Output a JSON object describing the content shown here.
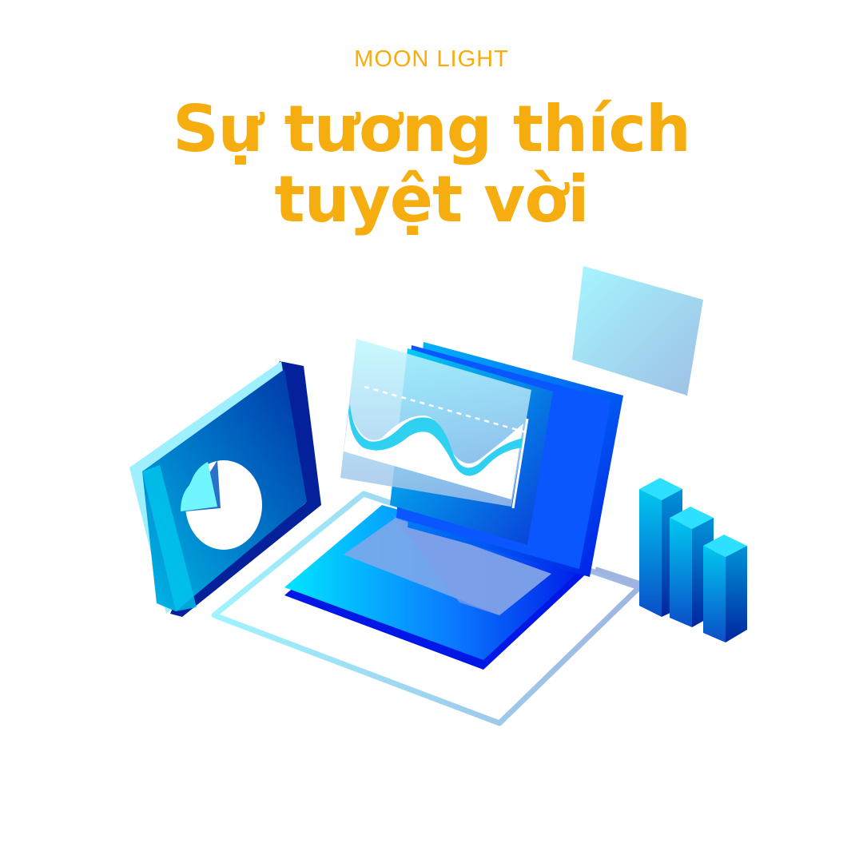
{
  "brand": "MOON LIGHT",
  "headline": {
    "line1": "Sự tương thích",
    "line2": "tuyệt vời"
  },
  "colors": {
    "accent": "#f6ad10",
    "blue_dark": "#0018e6",
    "blue_mid": "#0a7bff",
    "cyan": "#00e5ff",
    "pale_cyan": "#9ff4ff"
  },
  "illustration": {
    "icons": [
      "pie-chart-tablet-icon",
      "laptop-icon",
      "wave-chart-icon",
      "floating-card-icon",
      "bar-chart-icon"
    ]
  }
}
